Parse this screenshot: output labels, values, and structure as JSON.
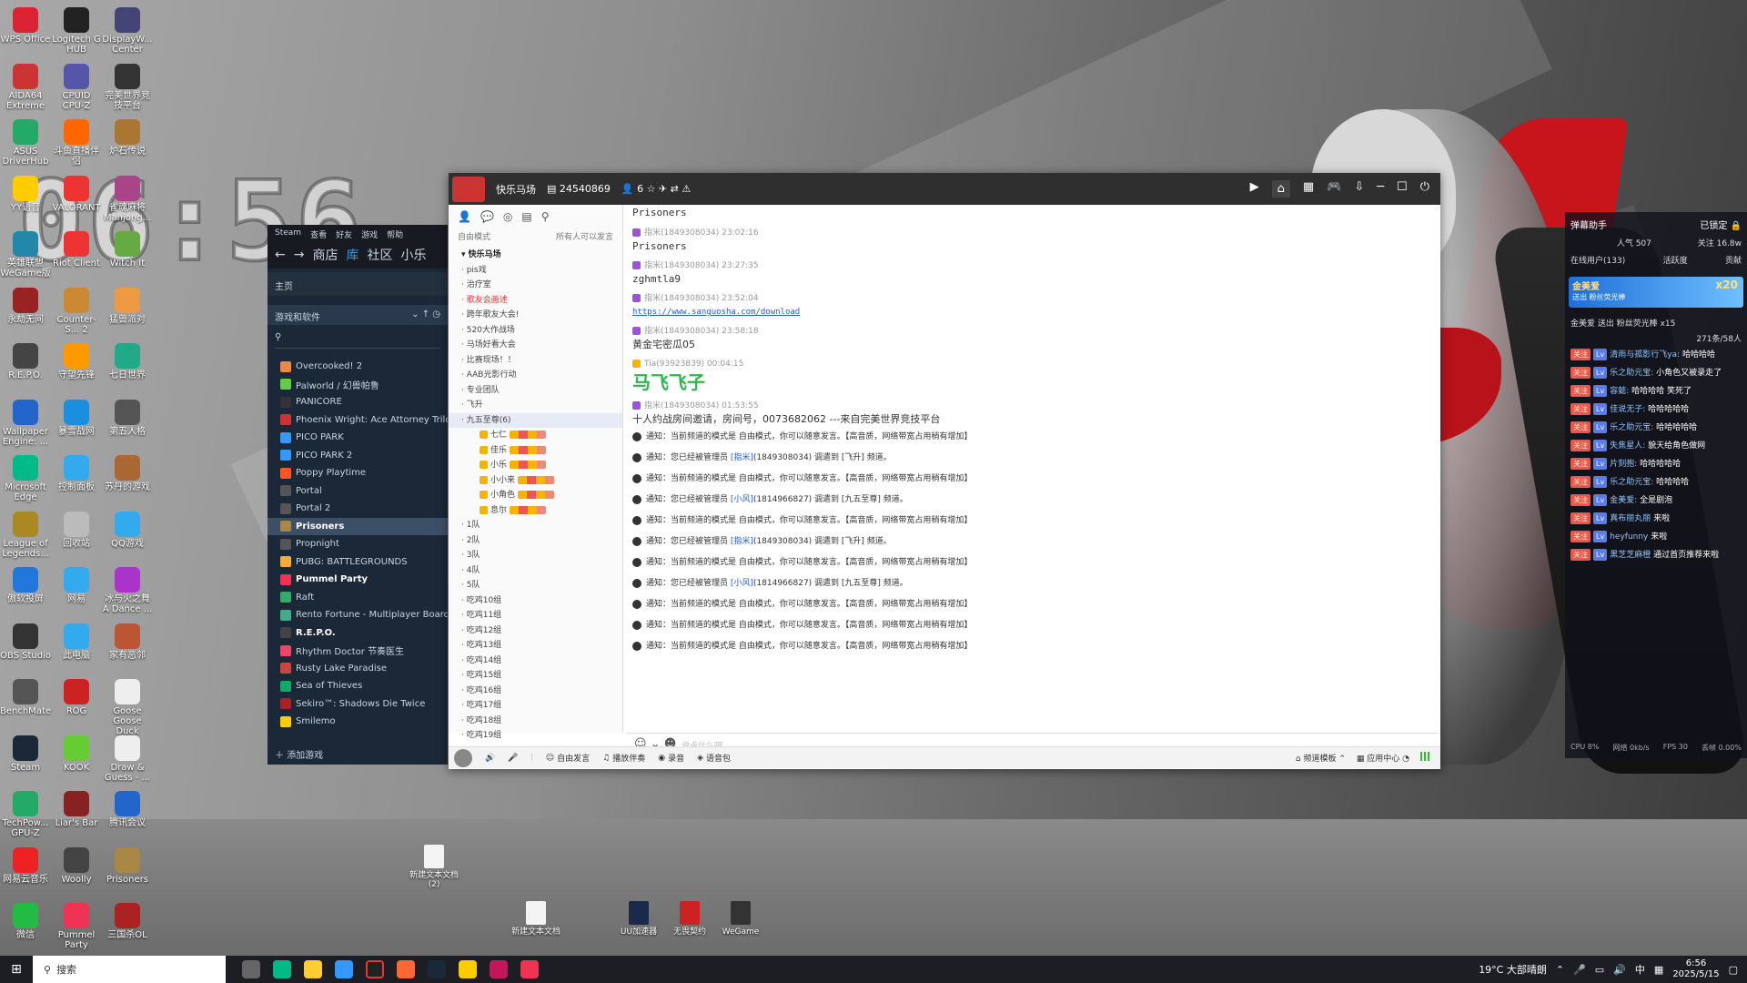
{
  "clock_overlay": "06:56",
  "desktop": {
    "icons": [
      {
        "label": "WPS Office",
        "color": "#d23"
      },
      {
        "label": "Logitech G HUB",
        "color": "#222"
      },
      {
        "label": "DisplayW... Center",
        "color": "#447"
      },
      {
        "label": "AIDA64 Extreme",
        "color": "#c33"
      },
      {
        "label": "CPUID CPU-Z",
        "color": "#55a"
      },
      {
        "label": "完美世界竞技平台",
        "color": "#333"
      },
      {
        "label": "ASUS DriverHub",
        "color": "#2a6"
      },
      {
        "label": "斗鱼直播伴侣",
        "color": "#f60"
      },
      {
        "label": "炉石传说",
        "color": "#a73"
      },
      {
        "label": "YY语音",
        "color": "#fc0"
      },
      {
        "label": "VALORANT",
        "color": "#e33"
      },
      {
        "label": "雀魂麻将 Mahjong...",
        "color": "#a48"
      },
      {
        "label": "英雄联盟 WeGame版",
        "color": "#28a"
      },
      {
        "label": "Riot Client",
        "color": "#e33"
      },
      {
        "label": "Witch It",
        "color": "#6a4"
      },
      {
        "label": "永劫无间",
        "color": "#922"
      },
      {
        "label": "Counter-S... 2",
        "color": "#c83"
      },
      {
        "label": "猛兽派对",
        "color": "#e94"
      },
      {
        "label": "R.E.P.O.",
        "color": "#444"
      },
      {
        "label": "守望先锋",
        "color": "#f90"
      },
      {
        "label": "七日世界",
        "color": "#2a8"
      },
      {
        "label": "Wallpaper Engine: ...",
        "color": "#26c"
      },
      {
        "label": "暴雪战网",
        "color": "#1a8fe0"
      },
      {
        "label": "第五人格",
        "color": "#555"
      },
      {
        "label": "Microsoft Edge",
        "color": "#0b8"
      },
      {
        "label": "控制面板",
        "color": "#3ae"
      },
      {
        "label": "苏丹的游戏",
        "color": "#a63"
      },
      {
        "label": "League of Legends...",
        "color": "#a82"
      },
      {
        "label": "回收站",
        "color": "#bbb"
      },
      {
        "label": "QQ游戏",
        "color": "#3ae"
      },
      {
        "label": "傲软投屏",
        "color": "#27d"
      },
      {
        "label": "网易",
        "color": "#3ae"
      },
      {
        "label": "冰与火之舞 A Dance ...",
        "color": "#a3c"
      },
      {
        "label": "OBS Studio",
        "color": "#333"
      },
      {
        "label": "此电脑",
        "color": "#3ae"
      },
      {
        "label": "家有恶邻",
        "color": "#b53"
      },
      {
        "label": "BenchMate",
        "color": "#555"
      },
      {
        "label": "ROG",
        "color": "#c22"
      },
      {
        "label": "Goose Goose Duck",
        "color": "#eee"
      },
      {
        "label": "Steam",
        "color": "#1b2838"
      },
      {
        "label": "KOOK",
        "color": "#6c3"
      },
      {
        "label": "Draw & Guess - ...",
        "color": "#eee"
      },
      {
        "label": "TechPow... GPU-Z",
        "color": "#2a6"
      },
      {
        "label": "Liar's Bar",
        "color": "#822"
      },
      {
        "label": "腾讯会议",
        "color": "#26c"
      },
      {
        "label": "网易云音乐",
        "color": "#e22"
      },
      {
        "label": "Woolly",
        "color": "#444"
      },
      {
        "label": "Prisoners",
        "color": "#a84"
      },
      {
        "label": "微信",
        "color": "#2b4"
      },
      {
        "label": "Pummel Party",
        "color": "#e35"
      },
      {
        "label": "三国杀OL",
        "color": "#a22"
      }
    ],
    "files": [
      {
        "label": "新建文本文档 (2)"
      },
      {
        "label": "新建文本文档"
      },
      {
        "label": "UU加速器"
      },
      {
        "label": "无畏契约"
      },
      {
        "label": "WeGame"
      }
    ]
  },
  "steam": {
    "menu": [
      "Steam",
      "查看",
      "好友",
      "游戏",
      "帮助"
    ],
    "nav": [
      "商店",
      "库",
      "社区",
      "小乐"
    ],
    "home": "主页",
    "filter": "游戏和软件",
    "games": [
      "Overcooked! 2",
      "Palworld / 幻兽帕鲁",
      "PANICORE",
      "Phoenix Wright: Ace Attorney Trilogy",
      "PICO PARK",
      "PICO PARK 2",
      "Poppy Playtime",
      "Portal",
      "Portal 2",
      "Prisoners",
      "Propnight",
      "PUBG: BATTLEGROUNDS",
      "Pummel Party",
      "Raft",
      "Rento Fortune - Multiplayer Board G",
      "R.E.P.O.",
      "Rhythm Doctor 节奏医生",
      "Rusty Lake Paradise",
      "Sea of Thieves",
      "Sekiro™: Shadows Die Twice",
      "Smilemo"
    ],
    "selected": "Prisoners",
    "add_game": "添加游戏"
  },
  "yy": {
    "channel_name": "快乐马场",
    "room_id": "24540869",
    "online": "6",
    "left_mode": "自由模式",
    "left_perm": "所有人可以发言",
    "channels": [
      {
        "name": "快乐马场",
        "style": "top"
      },
      {
        "name": "pis戏",
        "style": ""
      },
      {
        "name": "治疗室",
        "style": ""
      },
      {
        "name": "歌友会画述",
        "style": "red"
      },
      {
        "name": "跨年歌友大会!",
        "style": ""
      },
      {
        "name": "520大作战场",
        "style": ""
      },
      {
        "name": "马场好看大会",
        "style": ""
      },
      {
        "name": "比赛现场！！",
        "style": ""
      },
      {
        "name": "AAB光影行动",
        "style": ""
      },
      {
        "name": "专业团队",
        "style": ""
      },
      {
        "name": "飞升",
        "style": ""
      },
      {
        "name": "九五至尊(6)",
        "style": "sel"
      }
    ],
    "users": [
      "七仁",
      "佳乐",
      "小乐",
      "小小来",
      "小角色",
      "息尔"
    ],
    "channels2": [
      "1队",
      "2队",
      "3队",
      "4队",
      "5队",
      "吃鸡10组",
      "吃鸡11组",
      "吃鸡12组",
      "吃鸡13组",
      "吃鸡14组",
      "吃鸡15组",
      "吃鸡16组",
      "吃鸡17组",
      "吃鸡18组",
      "吃鸡19组"
    ],
    "chat_title": "Prisoners",
    "messages": [
      {
        "who": "指米(1849308034) 23:02:16",
        "text": "Prisoners",
        "cls": ""
      },
      {
        "who": "指米(1849308034) 23:27:35",
        "text": "zghmtla9",
        "cls": ""
      },
      {
        "who": "指米(1849308034) 23:52:04",
        "text": "https://www.sanguosha.com/download",
        "cls": "link"
      },
      {
        "who": "指米(1849308034) 23:58:18",
        "text": "黄金宅密瓜05",
        "cls": "cn"
      },
      {
        "who": "Tia(93923839) 00:04:15",
        "text": "马飞飞子",
        "cls": "big"
      },
      {
        "who": "指米(1849308034) 01:53:55",
        "text": "十人约战房间邀请，房间号，0073682062 ---来自完美世界竞技平台",
        "cls": "cn"
      }
    ],
    "notices": [
      {
        "pre": "通知：当前频道的模式是 自由模式，你可以随意发言。【高音质，网络带宽占用稍有增加】",
        "mention": "",
        "post": ""
      },
      {
        "pre": "通知：您已经被管理员 ",
        "mention": "[指米]",
        "post": "(1849308034) 调遣到 [飞升] 频道。"
      },
      {
        "pre": "通知：当前频道的模式是 自由模式，你可以随意发言。【高音质，网络带宽占用稍有增加】",
        "mention": "",
        "post": ""
      },
      {
        "pre": "通知：您已经被管理员 ",
        "mention": "[小风]",
        "post": "(1814966827) 调遣到 [九五至尊] 频道。"
      },
      {
        "pre": "通知：当前频道的模式是 自由模式，你可以随意发言。【高音质，网络带宽占用稍有增加】",
        "mention": "",
        "post": ""
      },
      {
        "pre": "通知：您已经被管理员 ",
        "mention": "[指米]",
        "post": "(1849308034) 调遣到 [飞升] 频道。"
      },
      {
        "pre": "通知：当前频道的模式是 自由模式，你可以随意发言。【高音质，网络带宽占用稍有增加】",
        "mention": "",
        "post": ""
      },
      {
        "pre": "通知：您已经被管理员 ",
        "mention": "[小风]",
        "post": "(1814966827) 调遣到 [九五至尊] 频道。"
      },
      {
        "pre": "通知：当前频道的模式是 自由模式，你可以随意发言。【高音质，网络带宽占用稍有增加】",
        "mention": "",
        "post": ""
      },
      {
        "pre": "通知：当前频道的模式是 自由模式，你可以随意发言。【高音质，网络带宽占用稍有增加】",
        "mention": "",
        "post": ""
      },
      {
        "pre": "通知：当前频道的模式是 自由模式，你可以随意发言。【高音质，网络带宽占用稍有增加】",
        "mention": "",
        "post": ""
      }
    ],
    "input_placeholder": "说点什么吧...",
    "bottom": {
      "free": "自由发言",
      "music": "播放伴奏",
      "record": "录音",
      "voicepack": "语音包",
      "template": "频道模板",
      "apps": "应用中心"
    }
  },
  "danmaku": {
    "title": "弹幕助手",
    "locked": "已锁定",
    "stats": [
      "人气 507",
      "关注 16.8w"
    ],
    "tabs": [
      "在线用户(133)",
      "活跃度",
      "贡献"
    ],
    "gift_name": "金美爱",
    "gift_sub": "送出 粉丝荧光棒",
    "gift_count": "x20",
    "gift2": "金美爱 送出 粉丝荧光棒 x15",
    "count": "271条/58人",
    "lines": [
      {
        "u": "清雨与孤影行飞ya:",
        "t": "哈哈哈哈"
      },
      {
        "u": "乐之助元宝:",
        "t": "小角色又被录走了"
      },
      {
        "u": "容懿:",
        "t": "哈哈哈哈 笑死了"
      },
      {
        "u": "佳说无子:",
        "t": "哈哈哈哈哈"
      },
      {
        "u": "乐之助元宝:",
        "t": "哈哈哈哈哈"
      },
      {
        "u": "失焦星人:",
        "t": "貌天给角色做网"
      },
      {
        "u": "片刻抱:",
        "t": "哈哈哈哈哈"
      },
      {
        "u": "乐之助元宝:",
        "t": "哈哈哈哈"
      },
      {
        "u": "金美爱:",
        "t": "全是剧泡"
      },
      {
        "u": "真布丽丸丽",
        "t": "来啦"
      },
      {
        "u": "heyfunny",
        "t": "来啦"
      },
      {
        "u": "黑芝芝麻橙",
        "t": "通过首页推荐来啦"
      }
    ],
    "footer": [
      "CPU 8%",
      "网络 0kb/s",
      "FPS 30",
      "丢帧 0.00%"
    ]
  },
  "taskbar": {
    "search": "搜索",
    "weather": "19°C 大部晴朗",
    "ime": "中",
    "time": "6:56",
    "date": "2025/5/15"
  }
}
